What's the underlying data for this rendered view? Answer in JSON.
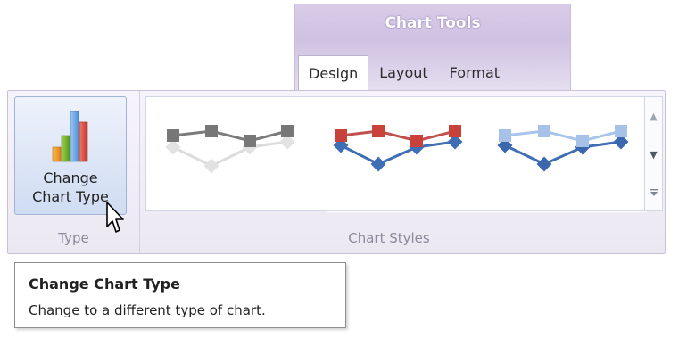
{
  "context_tabs": {
    "title": "Chart Tools",
    "color": "#cfc2e2",
    "tabs": [
      {
        "label": "Design",
        "active": true
      },
      {
        "label": "Layout",
        "active": false
      },
      {
        "label": "Format",
        "active": false
      }
    ]
  },
  "ribbon": {
    "type_group": {
      "label": "Type",
      "button": {
        "line1": "Change",
        "line2": "Chart Type",
        "icon": "bar-chart-icon"
      }
    },
    "styles_group": {
      "label": "Chart Styles",
      "gallery_items": [
        {
          "name": "gray-line-style",
          "primary": "#7f7f7f",
          "secondary": "#d8d8d8"
        },
        {
          "name": "red-blue-line-style",
          "primary": "#c0504d",
          "secondary": "#3f6eb5"
        },
        {
          "name": "blue-line-style",
          "primary": "#a9c4ea",
          "secondary": "#3f6eb5"
        }
      ],
      "scroll_icons": [
        "scroll-up-icon",
        "scroll-down-icon",
        "more-icon"
      ]
    }
  },
  "tooltip": {
    "title": "Change Chart Type",
    "body": "Change to a different type of chart."
  }
}
